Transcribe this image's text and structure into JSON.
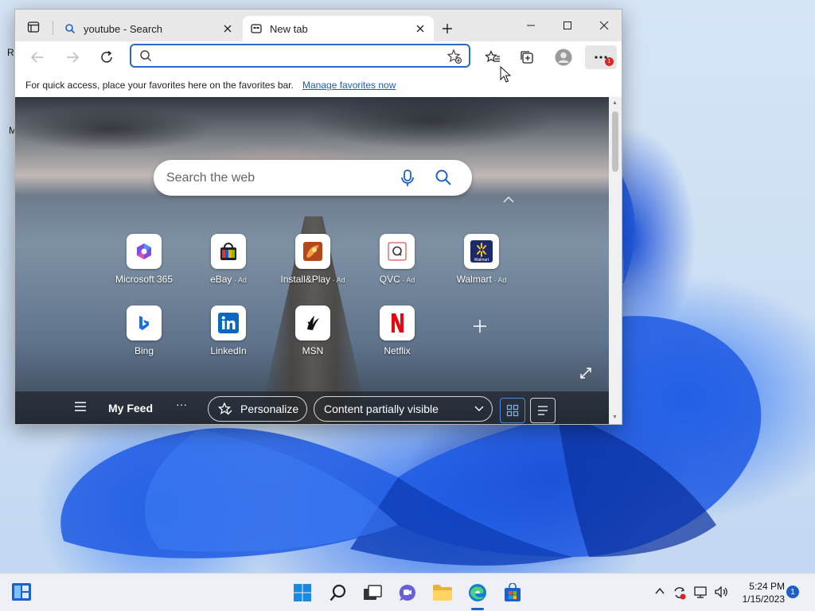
{
  "desktop": {
    "fragment_left_1": "R",
    "fragment_left_2": "M"
  },
  "browser": {
    "tabs": [
      {
        "title": "youtube - Search",
        "icon": "search-icon",
        "active": false
      },
      {
        "title": "New tab",
        "icon": "new-tab-page-icon",
        "active": true
      }
    ],
    "address": {
      "value": "",
      "placeholder": ""
    },
    "menu_badge": "1",
    "favorites_bar": {
      "message": "For quick access, place your favorites here on the favorites bar.",
      "link": "Manage favorites now"
    }
  },
  "newtab": {
    "search_placeholder": "Search the web",
    "quick_links": [
      {
        "label": "Microsoft 365",
        "ad": "",
        "icon": "microsoft-365-icon"
      },
      {
        "label": "eBay",
        "ad": " · Ad",
        "icon": "ebay-icon"
      },
      {
        "label": "Install&Play",
        "ad": " · Ad",
        "icon": "installplay-icon"
      },
      {
        "label": "QVC",
        "ad": " · Ad",
        "icon": "qvc-icon"
      },
      {
        "label": "Walmart",
        "ad": " · Ad",
        "icon": "walmart-icon"
      },
      {
        "label": "Bing",
        "ad": "",
        "icon": "bing-icon"
      },
      {
        "label": "LinkedIn",
        "ad": "",
        "icon": "linkedin-icon"
      },
      {
        "label": "MSN",
        "ad": "",
        "icon": "msn-icon"
      },
      {
        "label": "Netflix",
        "ad": "",
        "icon": "netflix-icon"
      }
    ],
    "walmart_tile_text": "Walmart",
    "feed": {
      "title": "My Feed",
      "more": "···",
      "personalize": "Personalize",
      "content_visibility": "Content partially visible"
    }
  },
  "taskbar": {
    "time": "5:24 PM",
    "date": "1/15/2023",
    "notifications": "1"
  },
  "colors": {
    "accent": "#2b69c9",
    "taskbar_bg": "#eef0f5",
    "badge_red": "#d42a2a"
  }
}
